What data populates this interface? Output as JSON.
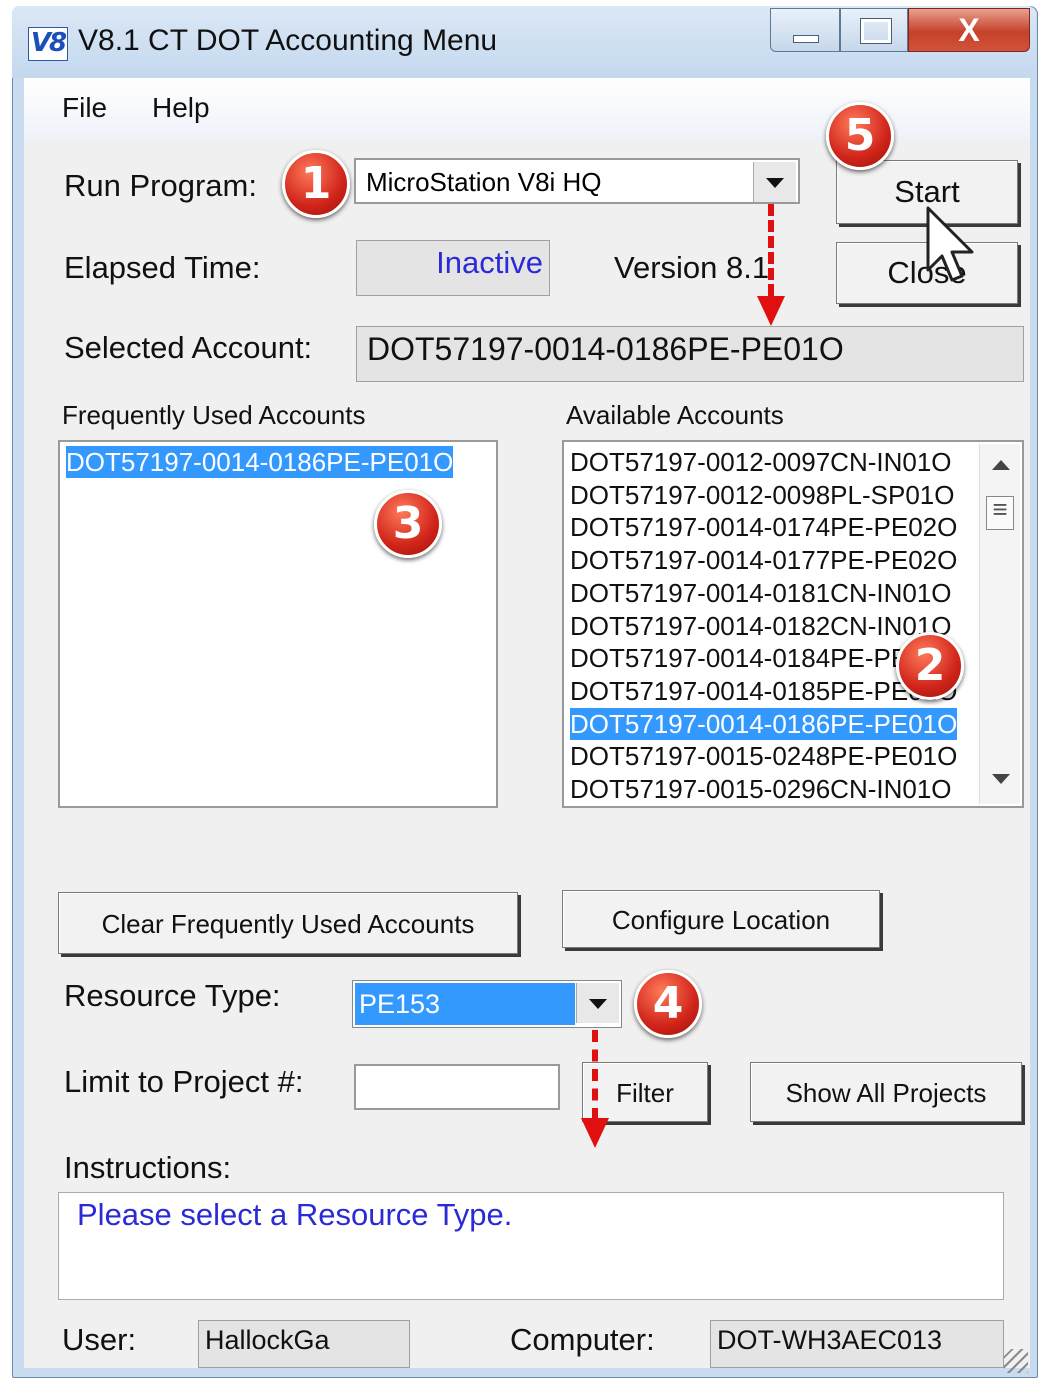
{
  "window": {
    "icon_text": "V8",
    "title": "V8.1 CT DOT Accounting Menu"
  },
  "menubar": {
    "file": "File",
    "help": "Help"
  },
  "run_program": {
    "label": "Run Program:",
    "value": "MicroStation V8i HQ"
  },
  "buttons": {
    "start": "Start",
    "close": "Close",
    "clear_frequent": "Clear Frequently Used Accounts",
    "configure_location": "Configure Location",
    "filter": "Filter",
    "show_all_projects": "Show All Projects"
  },
  "elapsed": {
    "label": "Elapsed Time:",
    "value": "Inactive"
  },
  "version": "Version 8.1",
  "selected_account": {
    "label": "Selected Account:",
    "value": "DOT57197-0014-0186PE-PE01O"
  },
  "frequent_accounts": {
    "header": "Frequently Used Accounts",
    "items": [
      "DOT57197-0014-0186PE-PE01O"
    ],
    "selected_index": 0
  },
  "available_accounts": {
    "header": "Available Accounts",
    "items": [
      "DOT57197-0012-0097CN-IN01O",
      "DOT57197-0012-0098PL-SP01O",
      "DOT57197-0014-0174PE-PE02O",
      "DOT57197-0014-0177PE-PE02O",
      "DOT57197-0014-0181CN-IN01O",
      "DOT57197-0014-0182CN-IN01O",
      "DOT57197-0014-0184PE-PE01O",
      "DOT57197-0014-0185PE-PE01O",
      "DOT57197-0014-0186PE-PE01O",
      "DOT57197-0015-0248PE-PE01O",
      "DOT57197-0015-0296CN-IN01O"
    ],
    "selected_index": 8
  },
  "resource_type": {
    "label": "Resource Type:",
    "value": "PE153"
  },
  "limit_project": {
    "label": "Limit to Project #:",
    "value": ""
  },
  "instructions": {
    "label": "Instructions:",
    "text": "Please select a Resource Type."
  },
  "user": {
    "label": "User:",
    "value": "HallockGa"
  },
  "computer": {
    "label": "Computer:",
    "value": "DOT-WH3AEC013"
  },
  "markers": [
    "1",
    "2",
    "3",
    "4",
    "5"
  ],
  "colors": {
    "accent": "#3399ff",
    "marker": "#d0241a",
    "instruction_text": "#2b2bd6"
  }
}
